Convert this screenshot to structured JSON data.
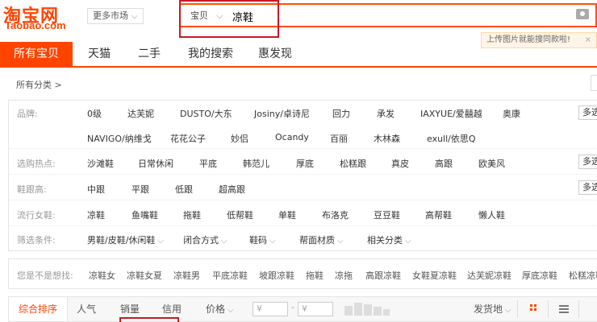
{
  "header": {
    "logo_cn": "淘宝网",
    "logo_en": "Taobao.com",
    "market_button": "更多市场",
    "search_category": "宝贝",
    "search_value": "凉鞋",
    "tip_text": "上传图片就能搜同款啦!",
    "tip_close": "×"
  },
  "tabs": [
    {
      "label": "所有宝贝",
      "active": true
    },
    {
      "label": "天猫",
      "active": false
    },
    {
      "label": "二手",
      "active": false
    },
    {
      "label": "我的搜索",
      "active": false
    },
    {
      "label": "惠发现",
      "active": false
    }
  ],
  "breadcrumb": "所有分类 >",
  "filters": {
    "brand": {
      "label": "品牌:",
      "row1": [
        "0级",
        "达芙妮",
        "DUSTO/大东",
        "Josiny/卓诗尼",
        "回力",
        "承发",
        "IAXYUE/爱囍越",
        "奥康"
      ],
      "row2": [
        "NAVIGO/纳维戈",
        "花花公子",
        "妙侣",
        "Ocandy",
        "百丽",
        "木林森",
        "exull/依思Q"
      ],
      "more": "多选"
    },
    "hot": {
      "label": "选购热点:",
      "items": [
        "沙滩鞋",
        "日常休闲",
        "平底",
        "韩范儿",
        "厚底",
        "松糕跟",
        "真皮",
        "高跟",
        "欧美风"
      ],
      "more": "多选"
    },
    "heel": {
      "label": "鞋跟高:",
      "items": [
        "中跟",
        "平跟",
        "低跟",
        "超高跟"
      ],
      "more": "多选"
    },
    "popular": {
      "label": "流行女鞋:",
      "items": [
        "凉鞋",
        "鱼嘴鞋",
        "拖鞋",
        "低帮鞋",
        "单鞋",
        "布洛克",
        "豆豆鞋",
        "高帮鞋",
        "懒人鞋"
      ]
    },
    "conditions": {
      "label": "筛选条件:",
      "items": [
        "男鞋/皮鞋/休闲鞋",
        "闭合方式",
        "鞋码",
        "帮面材质",
        "相关分类"
      ]
    }
  },
  "guess": {
    "label": "您是不是想找:",
    "items": [
      "凉鞋女",
      "凉鞋女夏",
      "凉鞋男",
      "平底凉鞋",
      "坡跟凉鞋",
      "拖鞋",
      "凉拖",
      "高跟凉鞋",
      "女鞋夏凉鞋",
      "达芙妮凉鞋",
      "厚底凉鞋",
      "松糕凉鞋"
    ]
  },
  "sortbar": {
    "items": [
      "综合排序",
      "人气",
      "销量",
      "信用",
      "价格"
    ],
    "price_from": "¥",
    "price_to": "¥",
    "price_dash": "-",
    "ship_from": "发货地",
    "chevron": "⌵"
  },
  "colors": {
    "accent": "#ff4400",
    "highlight": "#c9181f"
  }
}
